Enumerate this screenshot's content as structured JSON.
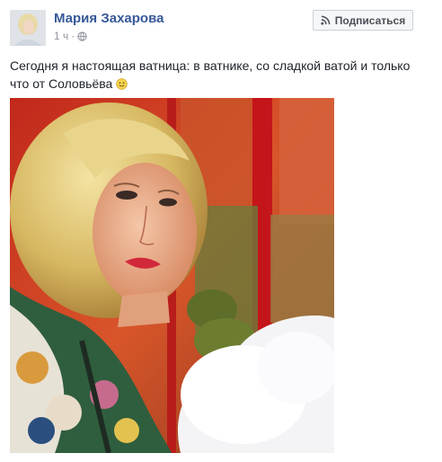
{
  "post": {
    "author": "Мария Захарова",
    "time": "1 ч",
    "separator": "·",
    "privacy_icon": "globe-icon",
    "subscribe_label": "Подписаться",
    "subscribe_icon": "rss-icon",
    "text_main": "Сегодня я настоящая ватница: в ватнике, со сладкой ватой и только что от Соловьёва",
    "text_emoji": "smile-emoji",
    "photo_icon": "photo"
  },
  "colors": {
    "author": "#365899",
    "meta": "#90949c",
    "text": "#1d2129",
    "button_bg": "#f6f7f9",
    "button_border": "#ccd0d5"
  }
}
